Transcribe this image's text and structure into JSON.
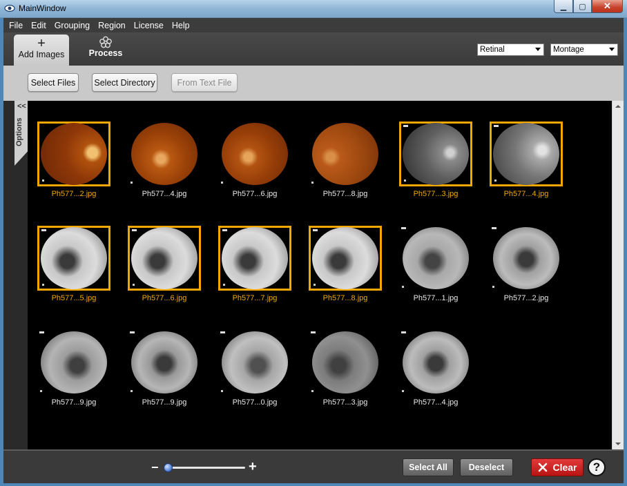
{
  "window": {
    "title": "MainWindow"
  },
  "menu": [
    "File",
    "Edit",
    "Grouping",
    "Region",
    "License",
    "Help"
  ],
  "tabs": {
    "add_images": "Add Images",
    "process": "Process"
  },
  "selects": {
    "mode": "Retinal",
    "layout": "Montage"
  },
  "buttons": {
    "select_files": "Select Files",
    "select_directory": "Select Directory",
    "from_text_file": "From Text File"
  },
  "options_label": "Options",
  "options_chevron": "<<",
  "thumbnails": [
    {
      "name": "Ph577...2.jpg",
      "selected": true
    },
    {
      "name": "Ph577...4.jpg",
      "selected": false
    },
    {
      "name": "Ph577...6.jpg",
      "selected": false
    },
    {
      "name": "Ph577...8.jpg",
      "selected": false
    },
    {
      "name": "Ph577...3.jpg",
      "selected": true
    },
    {
      "name": "Ph577...4.jpg",
      "selected": true
    },
    {
      "name": "Ph577...5.jpg",
      "selected": true
    },
    {
      "name": "Ph577...6.jpg",
      "selected": true
    },
    {
      "name": "Ph577...7.jpg",
      "selected": true
    },
    {
      "name": "Ph577...8.jpg",
      "selected": true
    },
    {
      "name": "Ph577...1.jpg",
      "selected": false
    },
    {
      "name": "Ph577...2.jpg",
      "selected": false
    },
    {
      "name": "Ph577...9.jpg",
      "selected": false
    },
    {
      "name": "Ph577...9.jpg",
      "selected": false
    },
    {
      "name": "Ph577...0.jpg",
      "selected": false
    },
    {
      "name": "Ph577...3.jpg",
      "selected": false
    },
    {
      "name": "Ph577...4.jpg",
      "selected": false
    }
  ],
  "bottom": {
    "zoom_minus": "−",
    "zoom_plus": "+",
    "zoom_level": 0.05,
    "select_all": "Select All",
    "deselect": "Deselect",
    "clear": "Clear",
    "help": "?"
  },
  "colors": {
    "selection": "#f2a800",
    "clear_button": "#c81c1c"
  }
}
